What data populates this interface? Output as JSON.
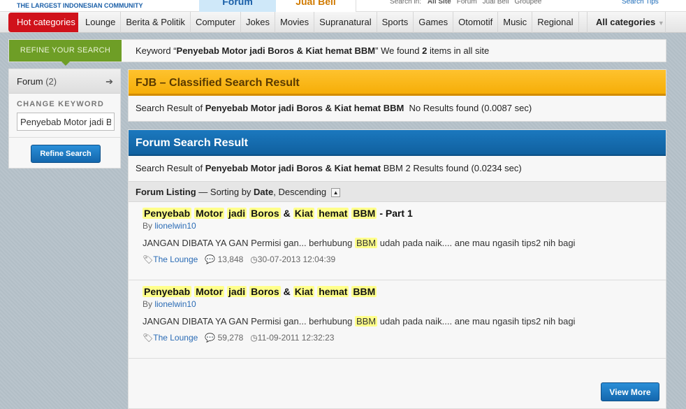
{
  "header": {
    "logo_tagline": "THE LARGEST INDONESIAN COMMUNITY",
    "tabs": [
      "Forum",
      "Jual Beli"
    ],
    "search_in_label": "Search in:",
    "search_in": [
      "All Site",
      "Forum",
      "Jual Beli",
      "Groupee"
    ],
    "search_tips": "Search Tips"
  },
  "nav": {
    "hot": "Hot categories",
    "items": [
      "Lounge",
      "Berita & Politik",
      "Computer",
      "Jokes",
      "Movies",
      "Supranatural",
      "Sports",
      "Games",
      "Otomotif",
      "Music",
      "Regional"
    ],
    "all": "All categories"
  },
  "refine": {
    "label": "REFINE YOUR SEARCH",
    "kw_prefix": "Keyword “",
    "keyword": "Penyebab Motor jadi Boros & Kiat hemat BBM",
    "kw_mid": "” We found ",
    "count": "2",
    "kw_suffix": " items in all site"
  },
  "sidebar": {
    "forum_label": "Forum",
    "forum_count": "(2)",
    "change_keyword": "CHANGE KEYWORD",
    "keyword_value": "Penyebab Motor jadi Boros & Kiat hemat BBM",
    "button": "Refine Search"
  },
  "fjb": {
    "title": "FJB – Classified Search Result",
    "prefix": "Search Result of ",
    "keyword": "Penyebab Motor jadi Boros & Kiat hemat BBM",
    "result": "No Results found (0.0087 sec)"
  },
  "forum": {
    "title": "Forum Search Result",
    "prefix": "Search Result of ",
    "keyword": "Penyebab Motor jadi Boros & Kiat hemat",
    "keyword_tail": "BBM",
    "result": "2 Results found (0.0234 sec)",
    "listing": {
      "label": "Forum Listing",
      "sort_prefix": " — Sorting by ",
      "sort": "Date",
      "order": ", Descending"
    },
    "items": [
      {
        "words": [
          "Penyebab",
          "Motor",
          "jadi",
          "Boros",
          "&",
          "Kiat",
          "hemat",
          "BBM"
        ],
        "suffix": "- Part 1",
        "by": "By ",
        "author": "lionelwin10",
        "snip_a": "JANGAN DIBATA YA GAN Permisi gan... berhubung ",
        "snip_hl": "BBM",
        "snip_b": " udah pada naik.... ane mau ngasih tips2 nih bagi",
        "category": "The Lounge",
        "replies": "13,848",
        "date": "30-07-2013 12:04:39"
      },
      {
        "words": [
          "Penyebab",
          "Motor",
          "jadi",
          "Boros",
          "&",
          "Kiat",
          "hemat",
          "BBM"
        ],
        "suffix": "",
        "by": "By ",
        "author": "lionelwin10",
        "snip_a": "JANGAN DIBATA YA GAN Permisi gan... berhubung ",
        "snip_hl": "BBM",
        "snip_b": " udah pada naik.... ane mau ngasih tips2 nih bagi",
        "category": "The Lounge",
        "replies": "59,278",
        "date": "11-09-2011 12:32:23"
      }
    ],
    "view_more": "View More"
  },
  "colors": {
    "hot": "#d0121b",
    "refine": "#6e9e26",
    "fjb": "#f6ae08",
    "forum": "#1467ad",
    "highlight": "#ffff8a"
  }
}
